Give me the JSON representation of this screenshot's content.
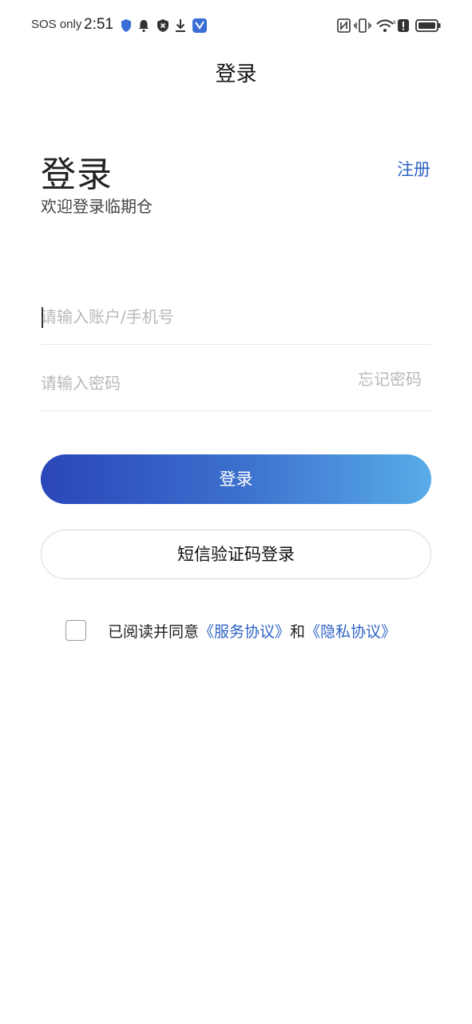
{
  "status_bar": {
    "carrier": "SOS only",
    "time": "2:51",
    "icons_left": [
      "shield-icon",
      "bell-icon",
      "blocked-icon",
      "download-icon",
      "app-icon"
    ],
    "icons_right": [
      "nfc-icon",
      "vibrate-icon",
      "wifi-icon",
      "alert-icon",
      "battery-icon"
    ]
  },
  "nav": {
    "title": "登录"
  },
  "header": {
    "title": "登录",
    "subtitle": "欢迎登录临期仓",
    "register_label": "注册"
  },
  "form": {
    "account_placeholder": "请输入账户/手机号",
    "account_value": "",
    "password_placeholder": "请输入密码",
    "password_value": "",
    "forgot_label": "忘记密码"
  },
  "actions": {
    "login_label": "登录",
    "sms_login_label": "短信验证码登录"
  },
  "agreement": {
    "checked": false,
    "prefix": "已阅读并同意",
    "service_link": "《服务协议》",
    "conjunction": "和",
    "privacy_link": "《隐私协议》"
  },
  "colors": {
    "accent": "#2f63c5",
    "gradient_start": "#2b46b9",
    "gradient_end": "#58abe8",
    "placeholder": "#b8b8b8"
  }
}
